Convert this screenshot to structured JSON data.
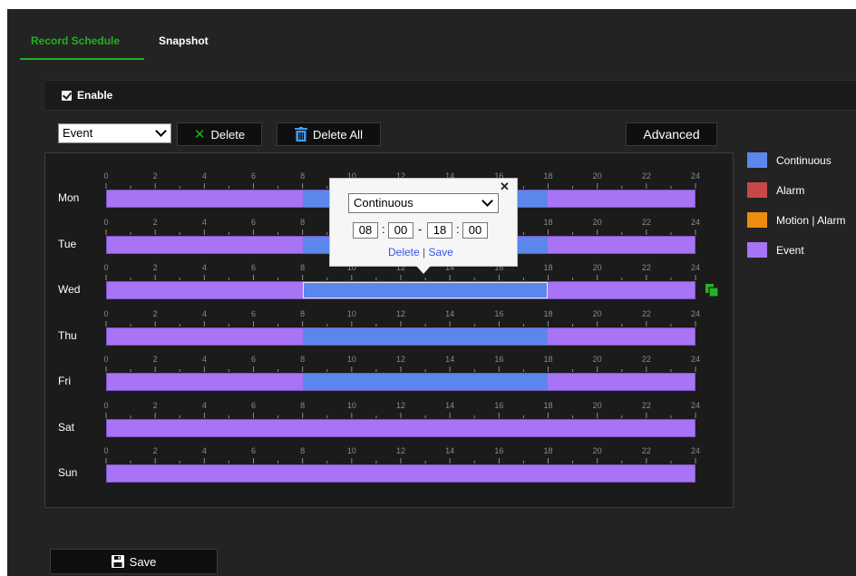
{
  "tabs": [
    {
      "label": "Record Schedule",
      "active": true
    },
    {
      "label": "Snapshot",
      "active": false
    }
  ],
  "enable": {
    "label": "Enable",
    "checked": true
  },
  "toolbar": {
    "type_value": "Event",
    "delete_label": "Delete",
    "delete_all_label": "Delete All",
    "advanced_label": "Advanced"
  },
  "hour_ticks": [
    "0",
    "2",
    "4",
    "6",
    "8",
    "10",
    "12",
    "14",
    "16",
    "18",
    "20",
    "22",
    "24"
  ],
  "days": [
    {
      "label": "Mon",
      "continuous": [
        8,
        18
      ]
    },
    {
      "label": "Tue",
      "continuous": [
        8,
        18
      ]
    },
    {
      "label": "Wed",
      "continuous": [
        8,
        18
      ]
    },
    {
      "label": "Thu",
      "continuous": [
        8,
        18
      ]
    },
    {
      "label": "Fri",
      "continuous": [
        8,
        18
      ]
    },
    {
      "label": "Sat",
      "continuous": null
    },
    {
      "label": "Sun",
      "continuous": null
    }
  ],
  "legend": [
    {
      "label": "Continuous",
      "color": "#5b87ec"
    },
    {
      "label": "Alarm",
      "color": "#c84848"
    },
    {
      "label": "Motion | Alarm",
      "color": "#ee8c10"
    },
    {
      "label": "Event",
      "color": "#a873f5"
    }
  ],
  "popup": {
    "type_value": "Continuous",
    "start_hour": "08",
    "start_min": "00",
    "end_hour": "18",
    "end_min": "00",
    "delete_label": "Delete",
    "separator": "|",
    "save_label": "Save",
    "close_label": "✕"
  },
  "footer": {
    "save_label": "Save"
  }
}
